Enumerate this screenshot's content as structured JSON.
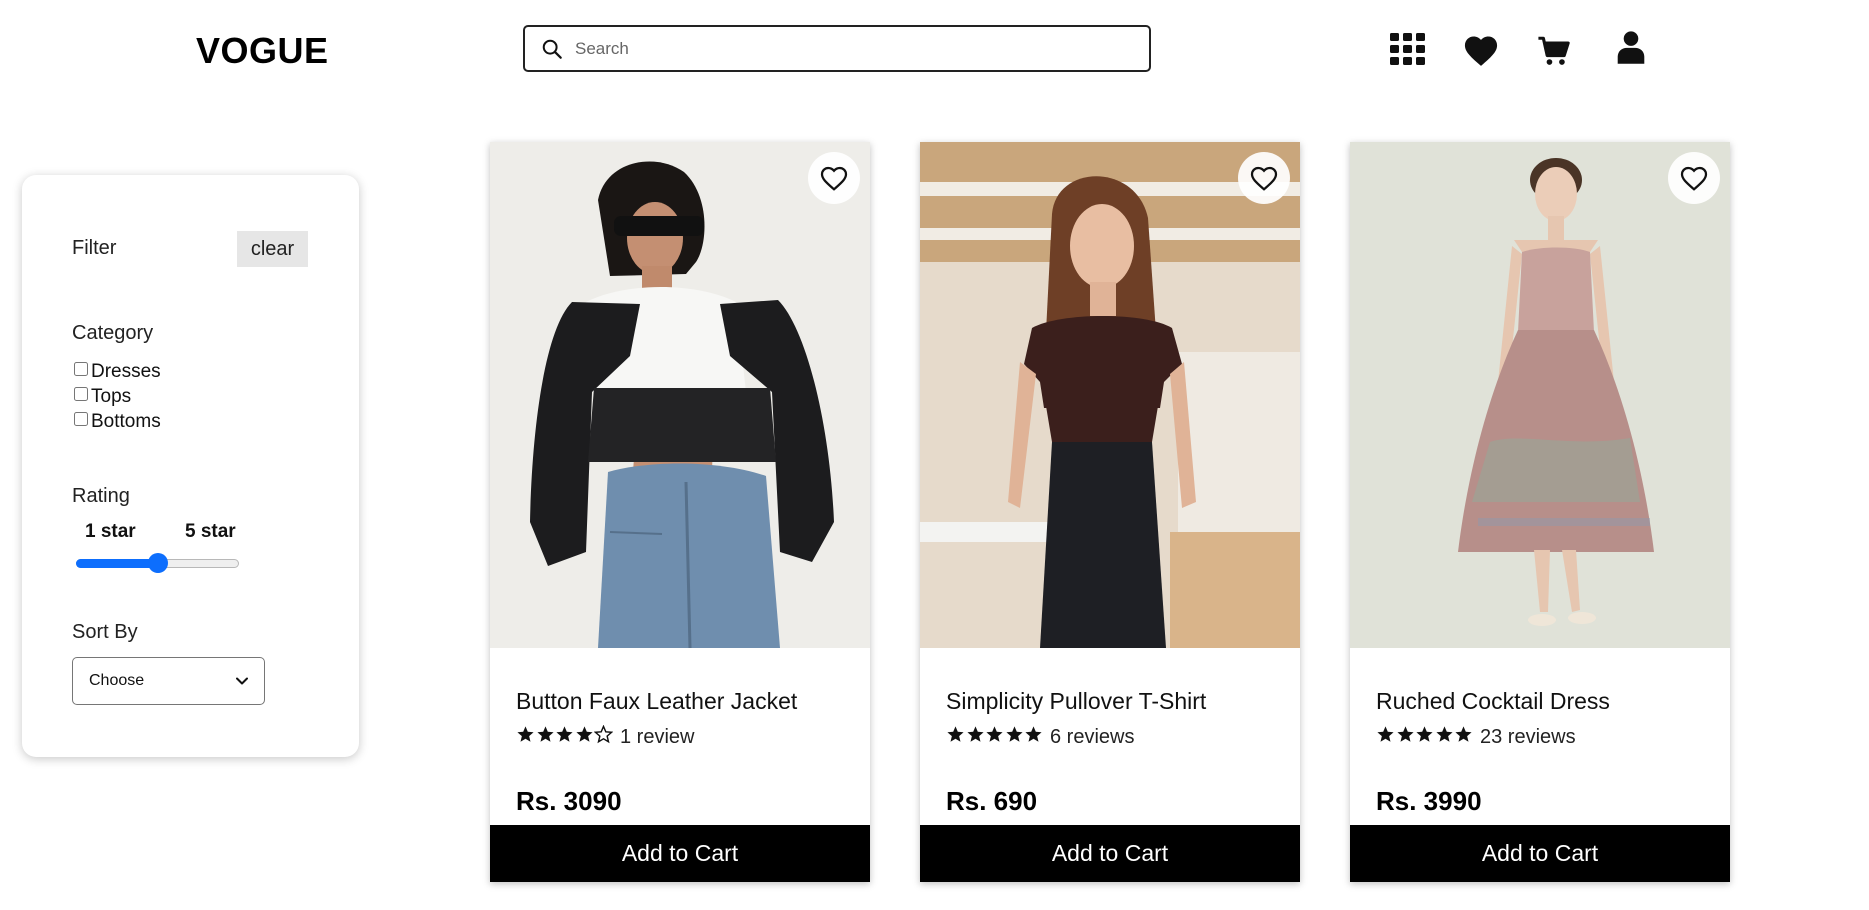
{
  "header": {
    "logo": "VOGUE",
    "search": {
      "placeholder": "Search",
      "value": ""
    },
    "icons": [
      "grid-icon",
      "heart-icon",
      "cart-icon",
      "user-icon"
    ]
  },
  "filter": {
    "title": "Filter",
    "clear_label": "clear",
    "category_heading": "Category",
    "categories": [
      {
        "label": "Dresses",
        "checked": false
      },
      {
        "label": "Tops",
        "checked": false
      },
      {
        "label": "Bottoms",
        "checked": false
      }
    ],
    "rating_heading": "Rating",
    "rating_min_label": "1 star",
    "rating_max_label": "5 star",
    "rating_slider_fraction": 0.5,
    "sort_heading": "Sort By",
    "sort_selected": "Choose"
  },
  "products": [
    {
      "name": "Button Faux Leather Jacket",
      "rating": 4,
      "reviews": "1 review",
      "price": "Rs. 3090",
      "cta": "Add to Cart"
    },
    {
      "name": "Simplicity Pullover T-Shirt",
      "rating": 5,
      "reviews": "6 reviews",
      "price": "Rs. 690",
      "cta": "Add to Cart"
    },
    {
      "name": "Ruched Cocktail Dress",
      "rating": 5,
      "reviews": "23 reviews",
      "price": "Rs. 3990",
      "cta": "Add to Cart"
    }
  ],
  "colors": {
    "accent": "#0d6efd",
    "button_bg": "#000000",
    "button_text": "#ffffff",
    "clear_bg": "#e6e6e6"
  }
}
